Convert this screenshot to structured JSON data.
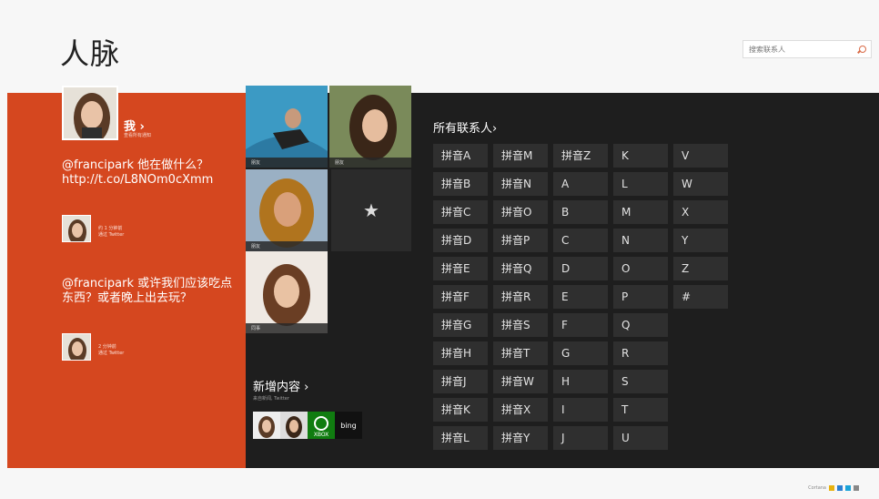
{
  "app_title": "人脉",
  "search": {
    "placeholder": "搜索联系人"
  },
  "me": {
    "name": "我 ›",
    "sub": "查看所有通知"
  },
  "posts": [
    {
      "text": "@francipark 他在做什么？ http://t.co/L8NOm0cXmm",
      "meta1": "约 1 分钟前",
      "meta2": "通过 Twitter"
    },
    {
      "text": "@francipark 或许我们应该吃点东西？或者晚上出去玩？",
      "meta1": "2 分钟前",
      "meta2": "通过 Twitter"
    }
  ],
  "tiles": [
    {
      "caption": "朋友"
    },
    {
      "caption": "朋友"
    },
    {
      "caption": "朋友"
    },
    {
      "caption": "同事"
    }
  ],
  "favorites_star": "★",
  "new_content": {
    "title": "新增内容  ›",
    "sub": "来自新闻, Twitter"
  },
  "new_content_labels": {
    "xbox": "XBOX",
    "bing": "bing"
  },
  "all_contacts": "所有联系人›",
  "index_columns": [
    [
      "拼音A",
      "拼音B",
      "拼音C",
      "拼音D",
      "拼音E",
      "拼音F",
      "拼音G",
      "拼音H",
      "拼音J",
      "拼音K",
      "拼音L"
    ],
    [
      "拼音M",
      "拼音N",
      "拼音O",
      "拼音P",
      "拼音Q",
      "拼音R",
      "拼音S",
      "拼音T",
      "拼音W",
      "拼音X",
      "拼音Y"
    ],
    [
      "拼音Z",
      "A",
      "B",
      "C",
      "D",
      "E",
      "F",
      "G",
      "H",
      "I",
      "J"
    ],
    [
      "K",
      "L",
      "M",
      "N",
      "O",
      "P",
      "Q",
      "R",
      "S",
      "T",
      "U"
    ],
    [
      "V",
      "W",
      "X",
      "Y",
      "Z",
      "#"
    ]
  ],
  "footer": {
    "label": "Cortana"
  },
  "colors": {
    "accent": "#d5471f",
    "dark_bg": "#1e1e1e",
    "cell": "#2f2f2f"
  }
}
